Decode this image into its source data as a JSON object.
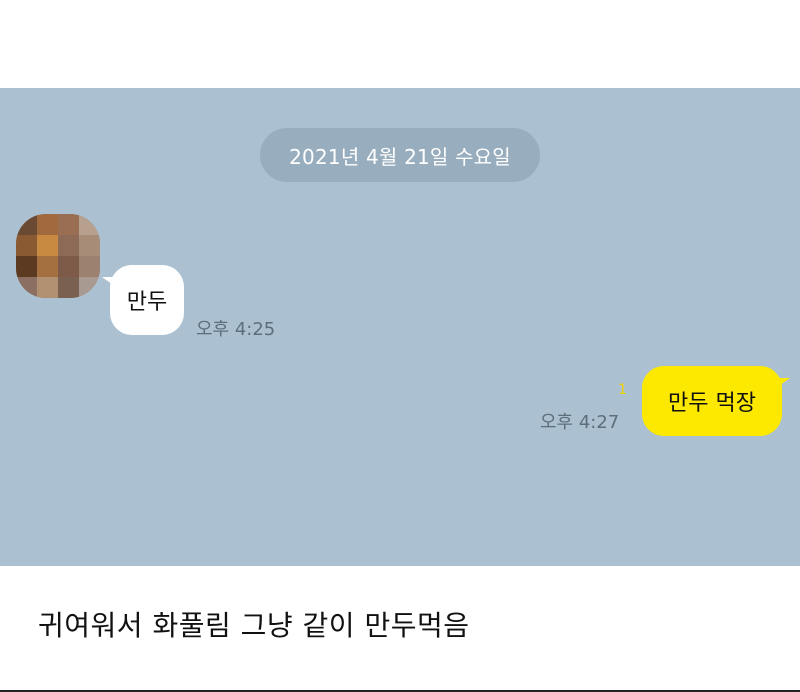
{
  "chat": {
    "date_label": "2021년 4월 21일 수요일",
    "incoming": {
      "text": "만두",
      "time": "오후 4:25"
    },
    "outgoing": {
      "text": "만두 먹장",
      "time": "오후 4:27",
      "unread_count": "1"
    }
  },
  "caption": "귀여워서 화풀림 그냥 같이 만두먹음",
  "colors": {
    "chat_background": "#abc1d1",
    "date_pill": "#98adbd",
    "outgoing_bubble": "#fde900",
    "incoming_bubble": "#ffffff",
    "unread": "#f0d200"
  }
}
